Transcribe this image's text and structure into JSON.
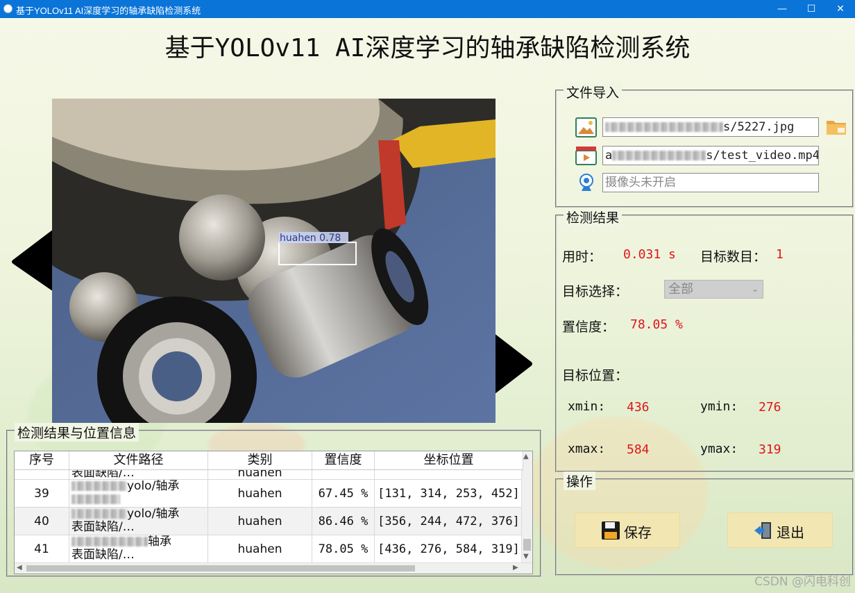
{
  "window": {
    "title": "基于YOLOv11 AI深度学习的轴承缺陷检测系统",
    "minimize": "—",
    "maximize": "☐",
    "close": "✕"
  },
  "main_title": "基于YOLOv11 AI深度学习的轴承缺陷检测系统",
  "viewer": {
    "detection_label": "huahen 0.78"
  },
  "file_import": {
    "title": "文件导入",
    "image_path": "s/5227.jpg",
    "video_path": "s/test_video.mp4",
    "video_prefix": "a",
    "camera_placeholder": "摄像头未开启"
  },
  "results": {
    "title": "检测结果",
    "time_label": "用时：",
    "time_value": "0.031 s",
    "count_label": "目标数目：",
    "count_value": "1",
    "select_label": "目标选择：",
    "select_value": "全部",
    "conf_label": "置信度：",
    "conf_value": "78.05 %",
    "pos_label": "目标位置：",
    "xmin_label": "xmin:",
    "xmin_value": "436",
    "ymin_label": "ymin:",
    "ymin_value": "276",
    "xmax_label": "xmax:",
    "xmax_value": "584",
    "ymax_label": "ymax:",
    "ymax_value": "319"
  },
  "ops": {
    "title": "操作",
    "save_label": "保存",
    "exit_label": "退出"
  },
  "table": {
    "title": "检测结果与位置信息",
    "headers": [
      "序号",
      "文件路径",
      "类别",
      "置信度",
      "坐标位置"
    ],
    "partial_row": {
      "class": "huahen",
      "conf": "",
      "coords": ""
    },
    "rows": [
      {
        "id": "39",
        "path1": "yolo/轴承",
        "path2": "",
        "class": "huahen",
        "conf": "67.45 %",
        "coords": "[131, 314, 253, 452]"
      },
      {
        "id": "40",
        "path1": "yolo/轴承",
        "path2": "表面缺陷/…",
        "class": "huahen",
        "conf": "86.46 %",
        "coords": "[356, 244, 472, 376]"
      },
      {
        "id": "41",
        "path1": "轴承",
        "path2": "表面缺陷/…",
        "class": "huahen",
        "conf": "78.05 %",
        "coords": "[436, 276, 584, 319]"
      }
    ],
    "top_partial_path": "表面缺陷/…"
  },
  "watermark": "CSDN @闪电科创"
}
